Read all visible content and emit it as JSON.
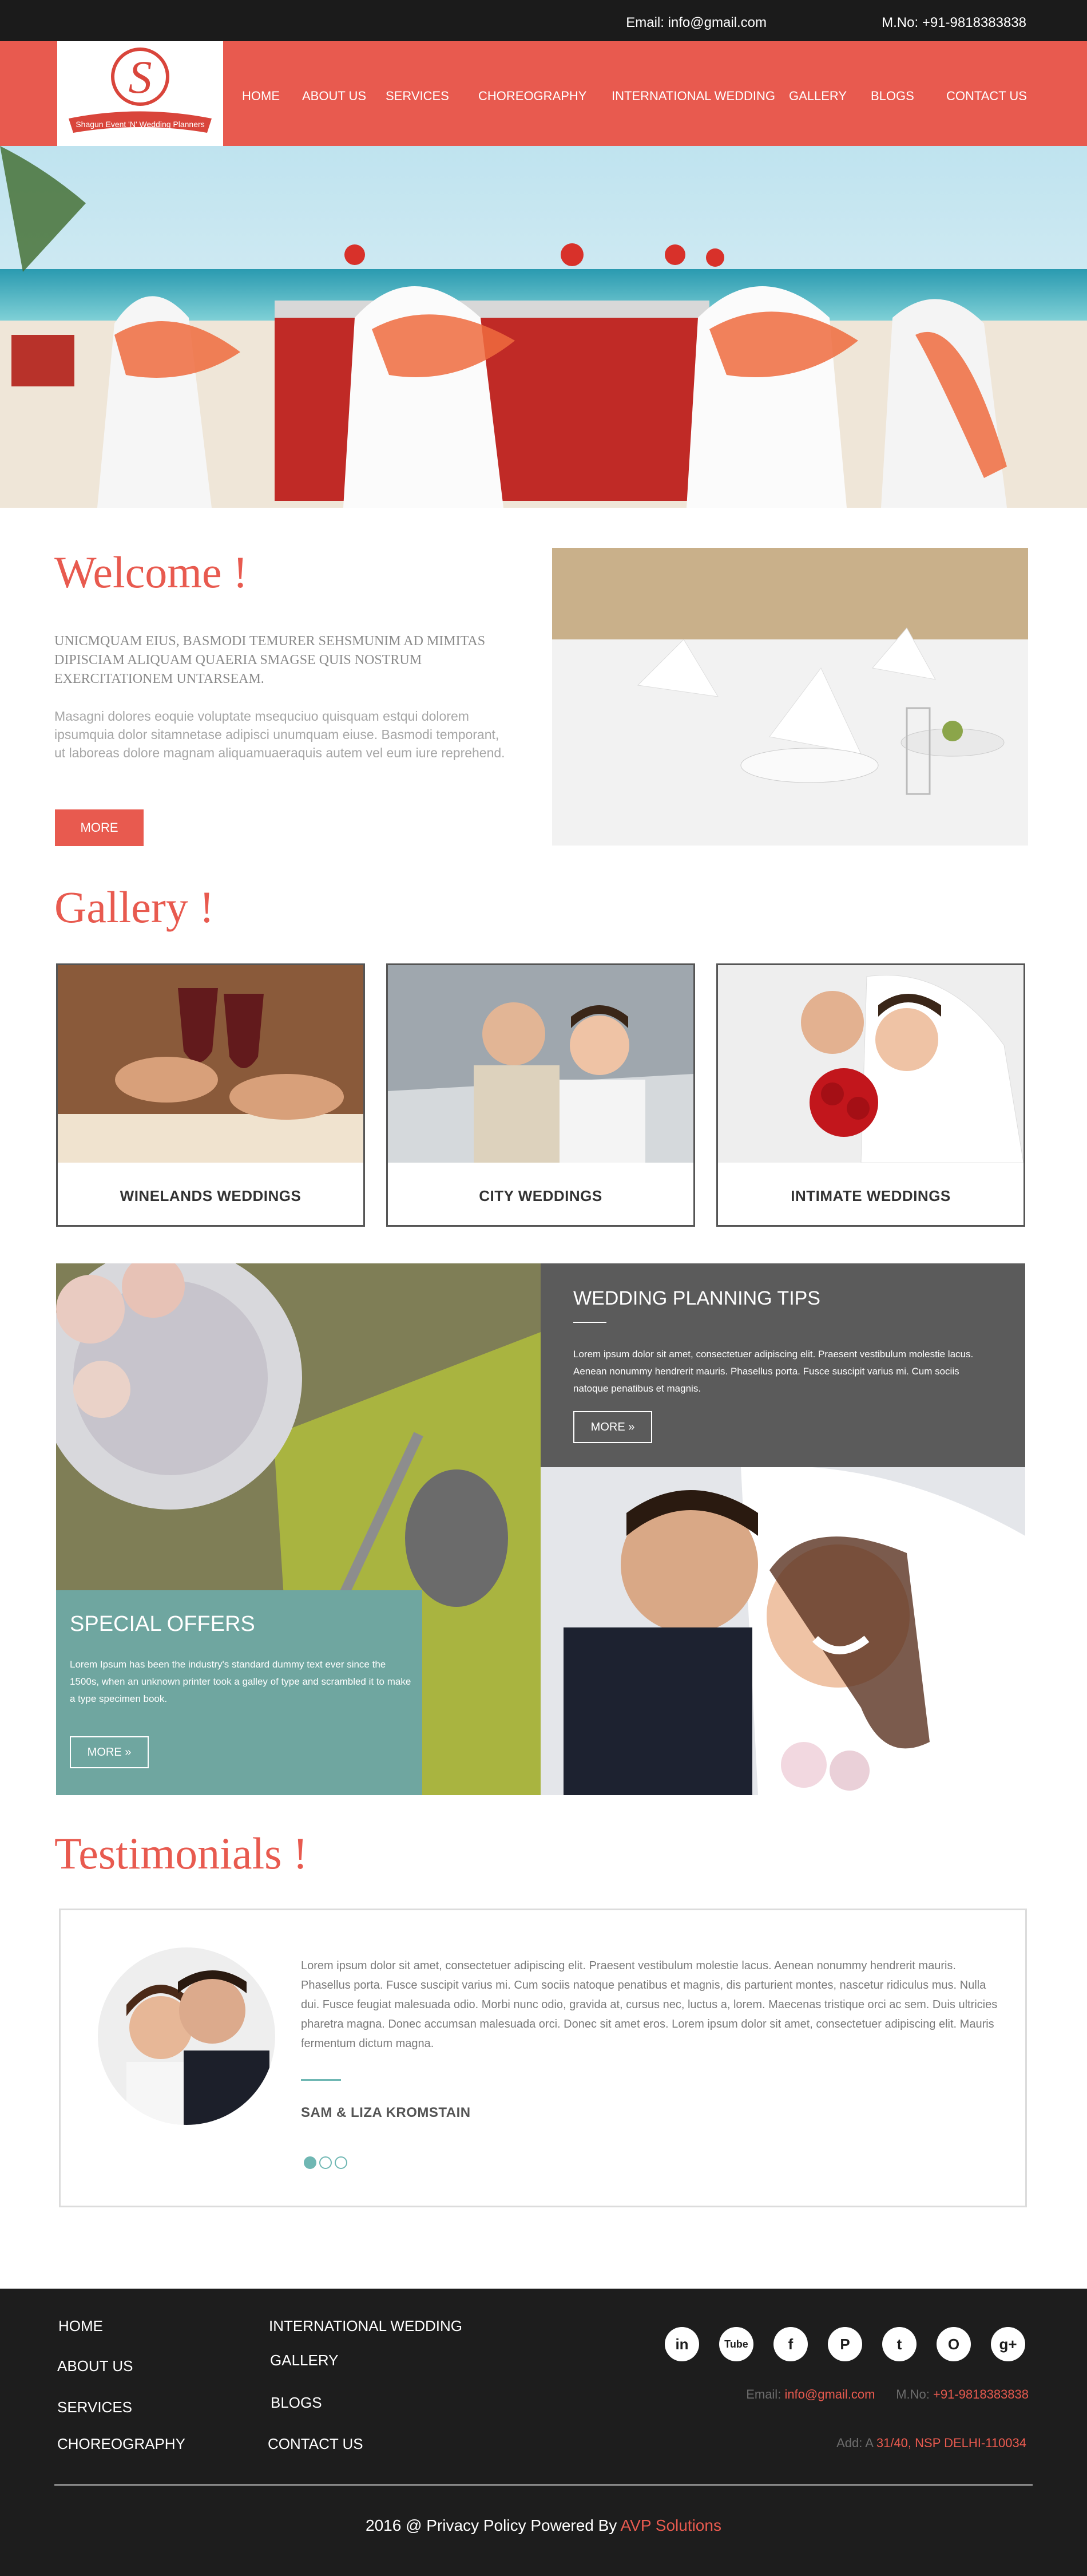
{
  "topbar": {
    "email": "Email: info@gmail.com",
    "mobile": "M.No: +91-9818383838"
  },
  "logo": {
    "brand": "Shagun Event 'N' Wedding Planners",
    "letter": "S"
  },
  "nav": {
    "items": [
      "HOME",
      "ABOUT US",
      "SERVICES",
      "CHOREOGRAPHY",
      "INTERNATIONAL WEDDING",
      "GALLERY",
      "BLOGS",
      "CONTACT US"
    ]
  },
  "welcome": {
    "title": "Welcome !",
    "subtitle": "UNICMQUAM EIUS, BASMODI TEMURER SEHSMUNIM AD MIMITAS DIPISCIAM ALIQUAM QUAERIA SMAGSE QUIS NOSTRUM EXERCITATIONEM UNTARSEAM.",
    "body": "Masagni dolores eoquie voluptate msequciuo quisquam estqui dolorem ipsumquia dolor sitamnetase adipisci unumquam eiuse. Basmodi temporant, ut laboreas dolore magnam aliquamuaeraquis autem vel eum iure reprehend.",
    "more_label": "MORE"
  },
  "gallery": {
    "title": "Gallery !",
    "cards": [
      {
        "label": "WINELANDS WEDDINGS"
      },
      {
        "label": "CITY WEDDINGS"
      },
      {
        "label": "INTIMATE WEDDINGS"
      }
    ]
  },
  "tips": {
    "title": "WEDDING PLANNING TIPS",
    "text": "Lorem ipsum dolor sit amet, consectetuer adipiscing elit. Praesent vestibulum molestie lacus. Aenean nonummy hendrerit mauris. Phasellus porta. Fusce suscipit varius mi. Cum sociis natoque penatibus et magnis.",
    "more_label": "MORE"
  },
  "offers": {
    "title": "SPECIAL OFFERS",
    "text": "Lorem Ipsum has been the industry's standard dummy text ever since the 1500s, when an unknown printer took a galley of type and scrambled it to make a type specimen book.",
    "more_label": "MORE"
  },
  "testimonials": {
    "title": "Testimonials !",
    "text": "Lorem ipsum dolor sit amet, consectetuer adipiscing elit. Praesent vestibulum molestie lacus. Aenean nonummy hendrerit mauris. Phasellus porta. Fusce suscipit varius mi. Cum sociis natoque penatibus et magnis, dis parturient montes, nascetur ridiculus mus. Nulla dui. Fusce feugiat malesuada odio. Morbi nunc odio, gravida at, cursus nec, luctus a, lorem. Maecenas tristique orci ac sem. Duis ultricies pharetra magna. Donec accumsan malesuada orci. Donec sit amet eros. Lorem ipsum dolor sit amet, consectetuer adipiscing elit. Mauris fermentum dictum magna.",
    "name": "SAM & LIZA KROMSTAIN",
    "active_slide": 1,
    "slide_count": 3
  },
  "footer": {
    "col1": [
      "HOME",
      "ABOUT US",
      "SERVICES",
      "CHOREOGRAPHY"
    ],
    "col2": [
      "INTERNATIONAL WEDDING",
      "GALLERY",
      "BLOGS",
      "CONTACT US"
    ],
    "social": [
      "linkedin-icon",
      "youtube-icon",
      "facebook-icon",
      "pinterest-icon",
      "twitter-icon",
      "instagram-icon",
      "googleplus-icon"
    ],
    "social_glyphs": [
      "in",
      "Tube",
      "f",
      "P",
      "t",
      "O",
      "g+"
    ],
    "email_label": "Email:",
    "email_value": "info@gmail.com",
    "mobile_label": "M.No:",
    "mobile_value": "+91-9818383838",
    "address_label": "Add: A",
    "address_value": "31/40, NSP DELHI-110034",
    "copyright_prefix": "2016 @ Privacy Policy Powered By",
    "copyright_brand": "AVP Solutions"
  },
  "colors": {
    "accent": "#e85a4f",
    "dark": "#1b1b1b",
    "teal": "#6fa6a0",
    "grey_box": "#5b5b5b"
  }
}
